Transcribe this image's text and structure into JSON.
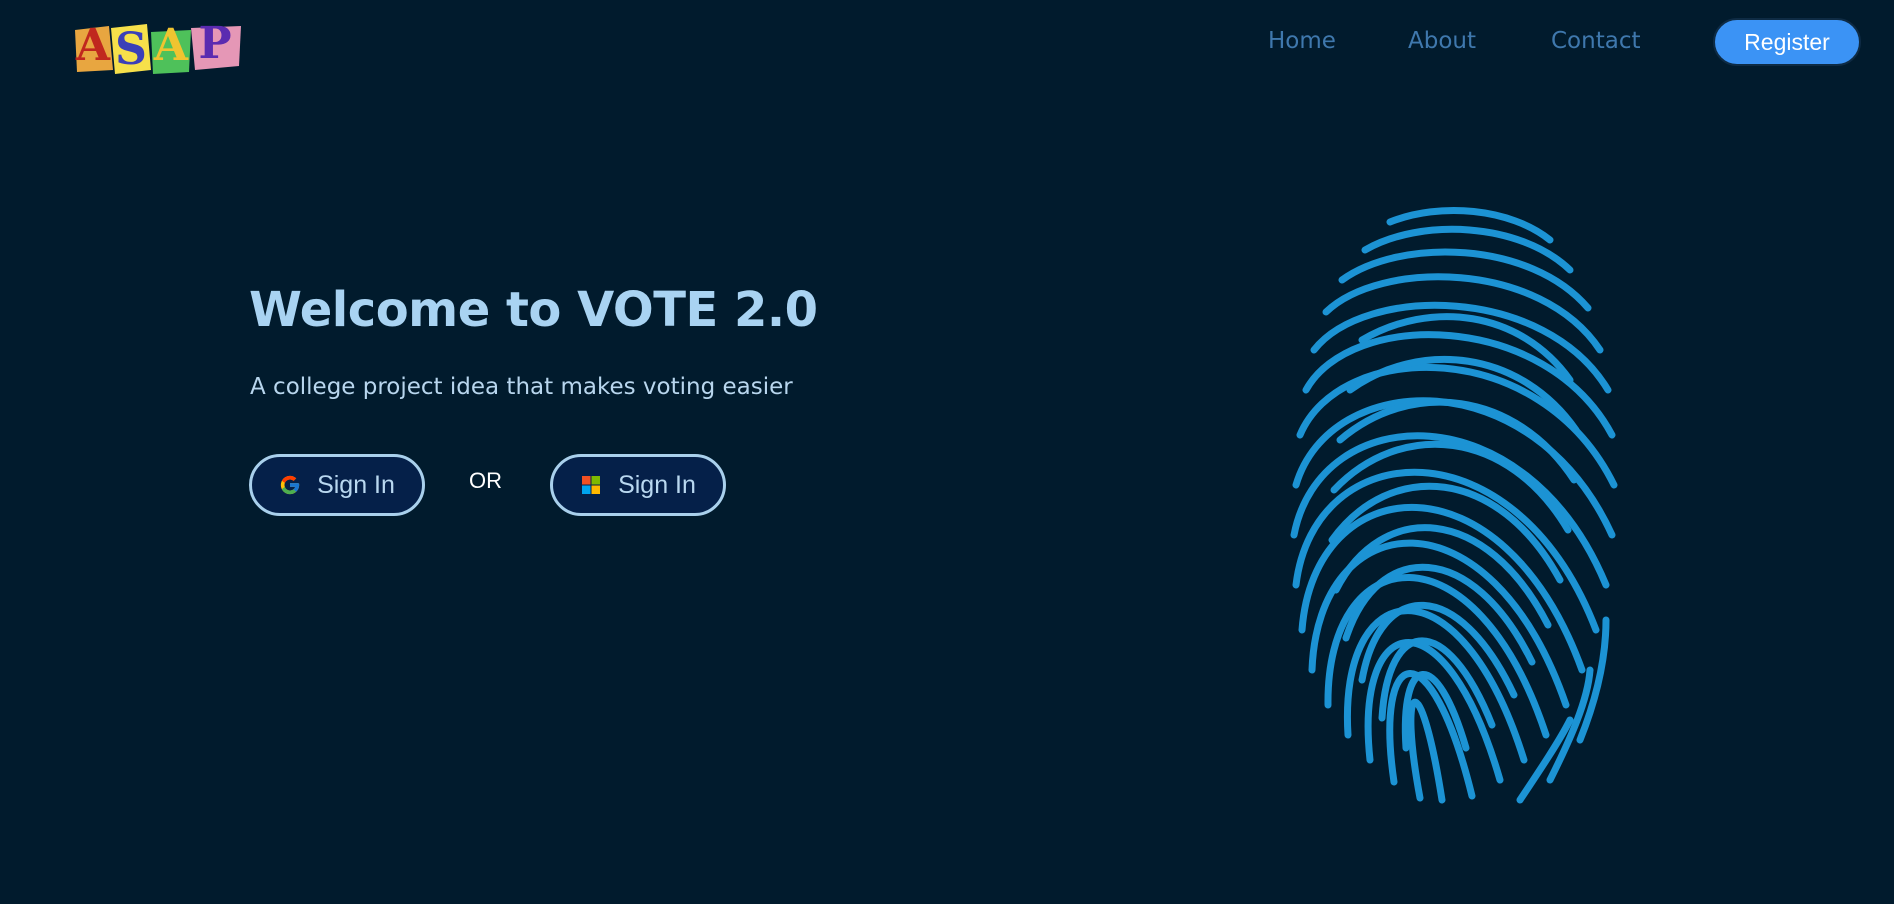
{
  "brand": {
    "logo_letters": [
      "A",
      "S",
      "A",
      "P"
    ],
    "logo_colors": {
      "tile_1": "#e8a640",
      "tile_2": "#f6e04a",
      "tile_3": "#4ec15a",
      "tile_4": "#e597b6",
      "letter_1": "#c0281e",
      "letter_2": "#3b3fb8",
      "letter_3": "#f0c430",
      "letter_4": "#5a2bb0"
    }
  },
  "nav": {
    "items": [
      {
        "label": "Home"
      },
      {
        "label": "About"
      },
      {
        "label": "Contact"
      }
    ],
    "register_label": "Register"
  },
  "hero": {
    "title": "Welcome to VOTE 2.0",
    "subtitle": "A college project idea that makes voting easier",
    "google_signin_label": "Sign In",
    "or_label": "OR",
    "microsoft_signin_label": "Sign In"
  },
  "icons": {
    "google": "google-icon",
    "microsoft": "microsoft-icon",
    "fingerprint": "fingerprint-icon"
  },
  "colors": {
    "background": "#011b2d",
    "title": "#a9d3f2",
    "nav_link": "#3f78ad",
    "register_bg": "#3b93f5",
    "fingerprint": "#1c93d4"
  }
}
